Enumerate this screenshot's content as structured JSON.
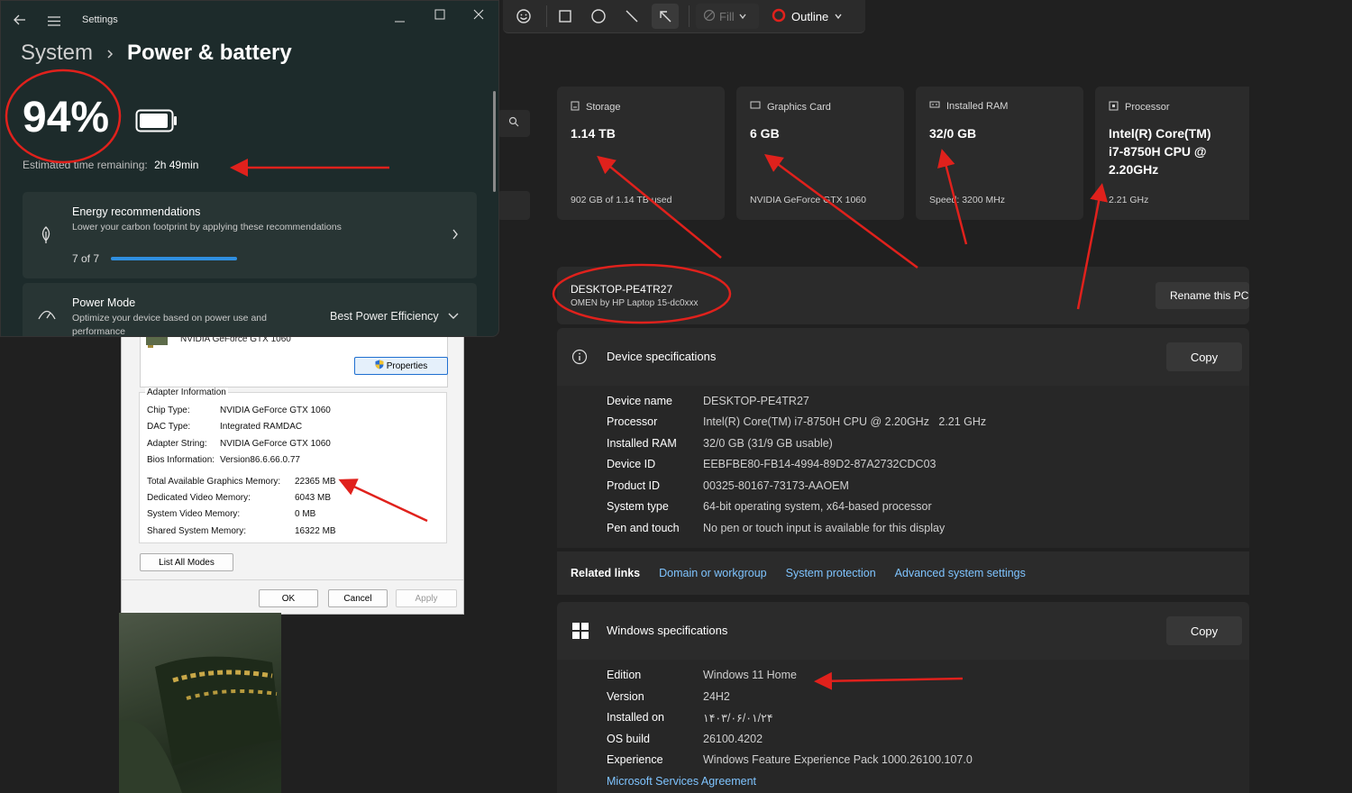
{
  "toolbar": {
    "fill_label": "Fill",
    "outline_label": "Outline",
    "outline_color": "#e0211c"
  },
  "cards": [
    {
      "icon": "storage-icon",
      "title": "Storage",
      "value": "1.14 TB",
      "sub": "902 GB of 1.14 TB used"
    },
    {
      "icon": "graphics-card-icon",
      "title": "Graphics Card",
      "value": "6 GB",
      "sub": "NVIDIA GeForce GTX 1060"
    },
    {
      "icon": "ram-icon",
      "title": "Installed RAM",
      "value": "32/0 GB",
      "sub": "Speed: 3200 MHz"
    },
    {
      "icon": "processor-icon",
      "title": "Processor",
      "value_lines": [
        "Intel(R) Core(TM)",
        "i7-8750H CPU @",
        "2.20GHz"
      ],
      "sub": "2.21 GHz"
    }
  ],
  "device": {
    "name": "DESKTOP-PE4TR27",
    "model": "OMEN by HP Laptop 15-dc0xxx",
    "rename_label": "Rename this PC"
  },
  "device_specs": {
    "title": "Device specifications",
    "copy_label": "Copy",
    "rows": [
      {
        "k": "Device name",
        "v": "DESKTOP-PE4TR27"
      },
      {
        "k": "Processor",
        "v": "Intel(R) Core(TM) i7-8750H CPU @ 2.20GHz   2.21 GHz"
      },
      {
        "k": "Installed RAM",
        "v": "32/0 GB (31/9 GB usable)"
      },
      {
        "k": "Device ID",
        "v": "EEBFBE80-FB14-4994-89D2-87A2732CDC03"
      },
      {
        "k": "Product ID",
        "v": "00325-80167-73173-AAOEM"
      },
      {
        "k": "System type",
        "v": "64-bit operating system, x64-based processor"
      },
      {
        "k": "Pen and touch",
        "v": "No pen or touch input is available for this display"
      }
    ]
  },
  "related": {
    "label": "Related links",
    "links": [
      "Domain or workgroup",
      "System protection",
      "Advanced system settings"
    ]
  },
  "windows_specs": {
    "title": "Windows specifications",
    "copy_label": "Copy",
    "rows": [
      {
        "k": "Edition",
        "v": "Windows 11 Home"
      },
      {
        "k": "Version",
        "v": "24H2"
      },
      {
        "k": "Installed on",
        "v": "۱۴۰۳/۰۶/۰۱/۲۴"
      },
      {
        "k": "OS build",
        "v": "26100.4202"
      },
      {
        "k": "Experience",
        "v": "Windows Feature Experience Pack 1000.26100.107.0"
      }
    ],
    "msa_link": "Microsoft Services Agreement"
  },
  "dialog": {
    "device_name": "NVIDIA GeForce GTX 1060",
    "properties_label": "Properties",
    "group_title": "Adapter Information",
    "rows": [
      {
        "k": "Chip Type:",
        "v": "NVIDIA GeForce GTX 1060"
      },
      {
        "k": "DAC Type:",
        "v": "Integrated RAMDAC"
      },
      {
        "k": "Adapter String:",
        "v": "NVIDIA GeForce GTX 1060"
      },
      {
        "k": "Bios Information:",
        "v": "Version86.6.66.0.77"
      }
    ],
    "mem_rows": [
      {
        "k": "Total Available Graphics Memory:",
        "v": "22365 MB"
      },
      {
        "k": "Dedicated Video Memory:",
        "v": "6043 MB"
      },
      {
        "k": "System Video Memory:",
        "v": "0 MB"
      },
      {
        "k": "Shared System Memory:",
        "v": "16322 MB"
      }
    ],
    "list_modes_label": "List All Modes",
    "ok_label": "OK",
    "cancel_label": "Cancel",
    "apply_label": "Apply"
  },
  "settings": {
    "window_title": "Settings",
    "breadcrumb_parent": "System",
    "breadcrumb_page": "Power & battery",
    "battery_percent": "94%",
    "battery_level": 0.94,
    "est_label": "Estimated time remaining:",
    "est_value": "2h 49min",
    "energy_title": "Energy recommendations",
    "energy_sub": "Lower your carbon footprint by applying these recommendations",
    "energy_count": "7 of 7",
    "energy_progress": 1.0,
    "power_title": "Power Mode",
    "power_sub": "Optimize your device based on power use and performance",
    "power_value": "Best Power Efficiency"
  },
  "colors": {
    "annotation_red": "#e0211c",
    "link_blue": "#7fc4ff",
    "progress_blue": "#2f8fe0"
  }
}
